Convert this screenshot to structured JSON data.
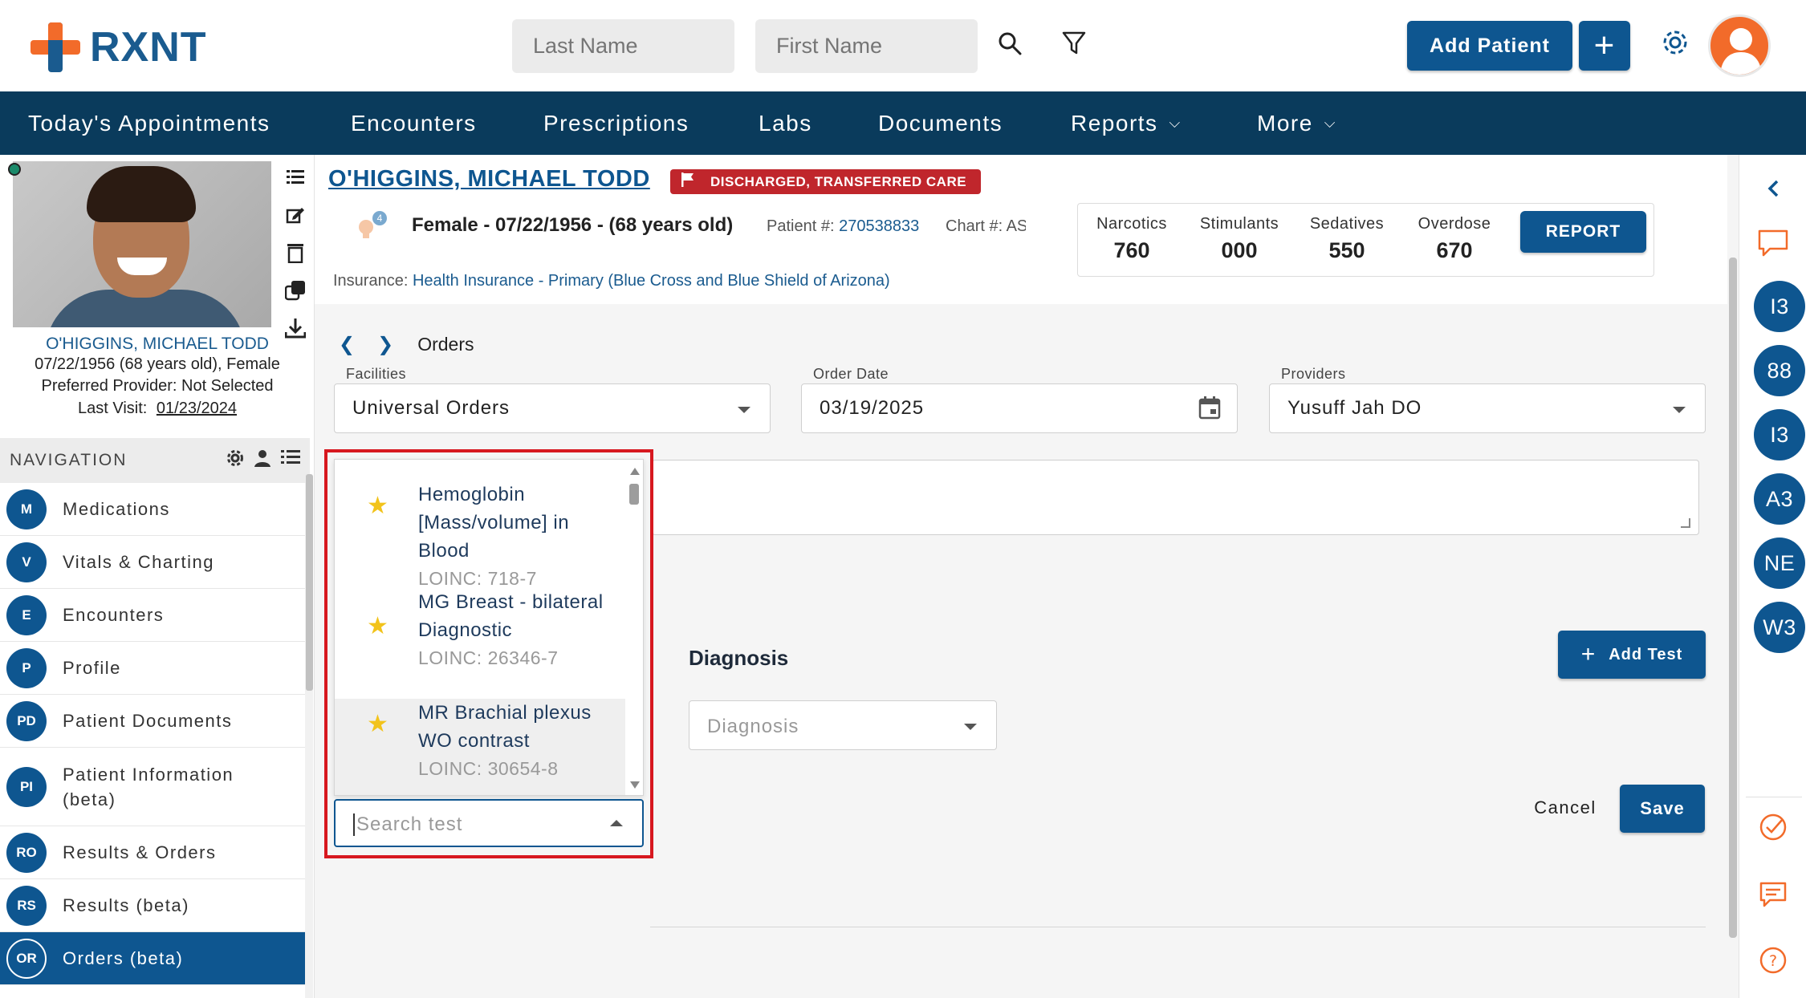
{
  "header": {
    "logo_text": "RXNT",
    "last_name_placeholder": "Last Name",
    "first_name_placeholder": "First Name",
    "add_patient_label": "Add Patient",
    "add_patient_plus": "+"
  },
  "nav": {
    "items": [
      {
        "label": "Today's Appointments"
      },
      {
        "label": "Encounters"
      },
      {
        "label": "Prescriptions"
      },
      {
        "label": "Labs"
      },
      {
        "label": "Documents"
      },
      {
        "label": "Reports",
        "dropdown": true
      },
      {
        "label": "More",
        "dropdown": true
      }
    ]
  },
  "patient_card": {
    "name": "O'HIGGINS, MICHAEL TODD",
    "dob_line": "07/22/1956 (68 years old), Female",
    "provider_line": "Preferred Provider: Not Selected",
    "last_visit_label": "Last Visit:",
    "last_visit_date": "01/23/2024"
  },
  "sidebar_nav": {
    "heading": "NAVIGATION",
    "items": [
      {
        "badge": "M",
        "label": "Medications"
      },
      {
        "badge": "V",
        "label": "Vitals & Charting"
      },
      {
        "badge": "E",
        "label": "Encounters"
      },
      {
        "badge": "P",
        "label": "Profile"
      },
      {
        "badge": "PD",
        "label": "Patient Documents"
      },
      {
        "badge": "PI",
        "label": "Patient Information (beta)"
      },
      {
        "badge": "RO",
        "label": "Results & Orders"
      },
      {
        "badge": "RS",
        "label": "Results (beta)"
      },
      {
        "badge": "OR",
        "label": "Orders (beta)",
        "active": true
      }
    ]
  },
  "patient_header": {
    "name": "O'HIGGINS, MICHAEL TODD",
    "status": "DISCHARGED, TRANSFERRED CARE",
    "alert_count": "4",
    "demographics": "Female - 07/22/1956 - (68 years old)",
    "patient_num_label": "Patient #:",
    "patient_num": "270538833",
    "chart_label": "Chart #: ASDFGHJ",
    "insurance_label": "Insurance:",
    "insurance_value": "Health Insurance - Primary (Blue Cross and Blue Shield of Arizona)",
    "pdmp": [
      {
        "label": "Narcotics",
        "value": "760"
      },
      {
        "label": "Stimulants",
        "value": "000"
      },
      {
        "label": "Sedatives",
        "value": "550"
      },
      {
        "label": "Overdose",
        "value": "670"
      }
    ],
    "report_label": "REPORT"
  },
  "orders": {
    "breadcrumb_title": "Orders",
    "facilities_label": "Facilities",
    "facilities_value": "Universal Orders",
    "order_date_label": "Order Date",
    "order_date_value": "03/19/2025",
    "providers_label": "Providers",
    "providers_value": "Yusuff Jah DO",
    "diagnosis_heading": "Diagnosis",
    "add_test_label": "Add Test",
    "diagnosis_placeholder": "Diagnosis",
    "search_test_placeholder": "Search test",
    "cancel_label": "Cancel",
    "save_label": "Save",
    "test_options": [
      {
        "name": "Hemoglobin [Mass/volume] in Blood",
        "code": "LOINC: 718-7",
        "favorite": true
      },
      {
        "name": "MG Breast - bilateral Diagnostic",
        "code": "LOINC: 26346-7",
        "favorite": true
      },
      {
        "name": "MR Brachial plexus WO contrast",
        "code": "LOINC: 30654-8",
        "favorite": true
      }
    ]
  },
  "right_rail": {
    "bubbles": [
      "I3",
      "88",
      "I3",
      "A3",
      "NE",
      "W3"
    ]
  },
  "colors": {
    "brand_blue": "#0e5690",
    "nav_dark": "#0a3b5c",
    "logo_orange": "#f26b2a",
    "alert_red": "#c0262c",
    "highlight_red": "#d7181f",
    "star_yellow": "#f2c31b"
  }
}
